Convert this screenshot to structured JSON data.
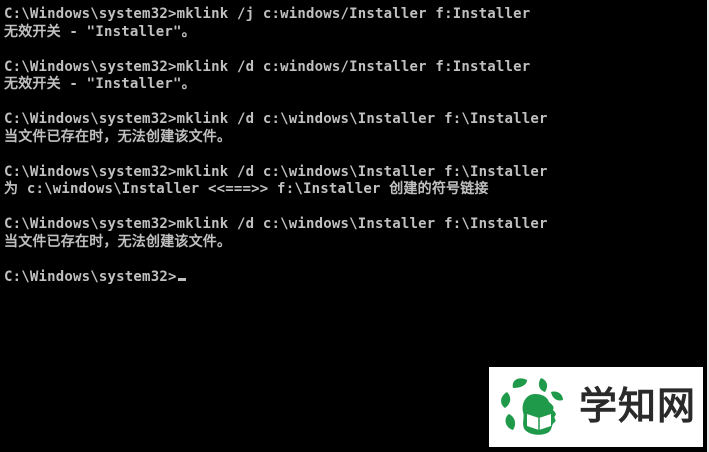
{
  "console": {
    "lines": [
      "C:\\Windows\\system32>mklink /j c:windows/Installer f:Installer",
      "无效开关 - \"Installer\"。",
      "",
      "C:\\Windows\\system32>mklink /d c:windows/Installer f:Installer",
      "无效开关 - \"Installer\"。",
      "",
      "C:\\Windows\\system32>mklink /d c:\\windows\\Installer f:\\Installer",
      "当文件已存在时，无法创建该文件。",
      "",
      "C:\\Windows\\system32>mklink /d c:\\windows\\Installer f:\\Installer",
      "为 c:\\windows\\Installer <<===>> f:\\Installer 创建的符号链接",
      "",
      "C:\\Windows\\system32>mklink /d c:\\windows\\Installer f:\\Installer",
      "当文件已存在时，无法创建该文件。",
      "",
      "C:\\Windows\\system32>"
    ],
    "text_color": "#c0c0c0",
    "background_color": "#000000"
  },
  "watermark": {
    "text": "学知网",
    "icon": "leaf-person-logo-icon",
    "logo_color": "#1f9a4a"
  }
}
